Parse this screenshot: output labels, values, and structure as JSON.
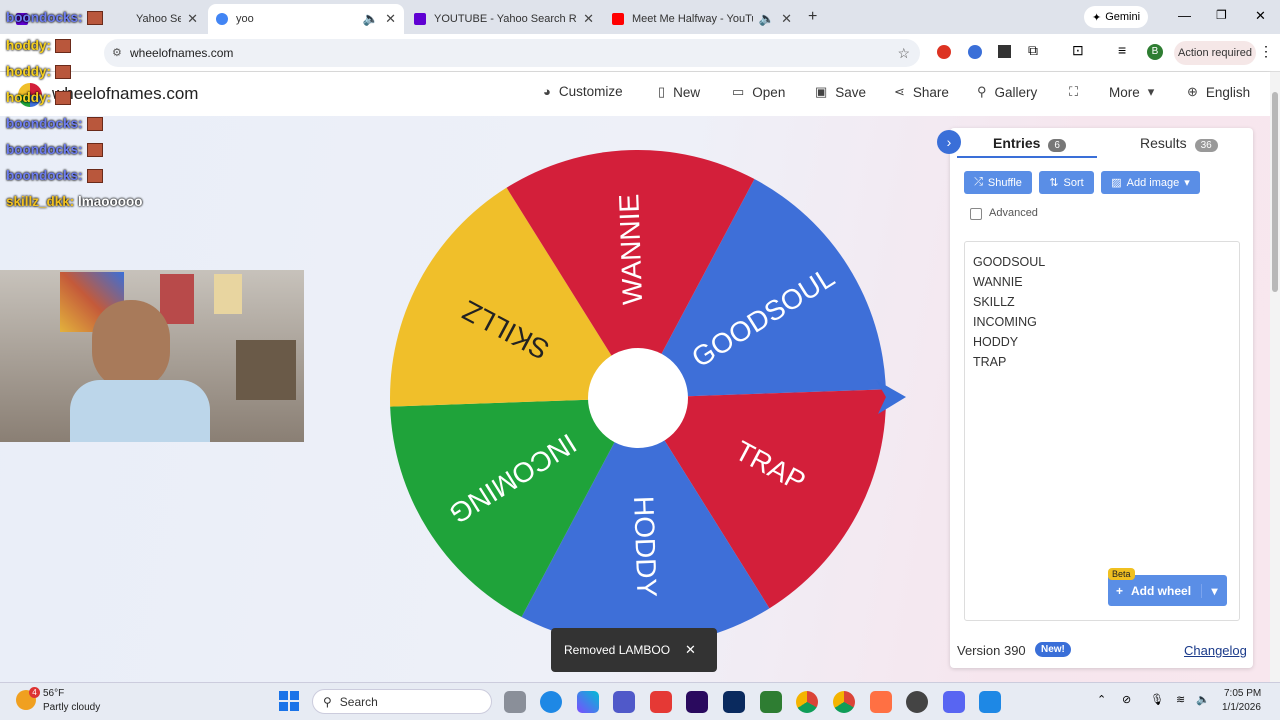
{
  "tabs": [
    {
      "title": "Yahoo Search",
      "favicon_color": "#6001d2"
    },
    {
      "title": "yoo",
      "favicon_color": "#4285f4"
    },
    {
      "title": "YOUTUBE - Yahoo Search Results",
      "favicon_color": "#6001d2"
    },
    {
      "title": "Meet Me Halfway - YouTube",
      "favicon_color": "#ff0000"
    }
  ],
  "gemini_label": "Gemini",
  "address": {
    "url": "wheelofnames.com",
    "action_required": "Action required",
    "profile_initial": "B"
  },
  "site": {
    "logo": "wheelofnames.com",
    "nav": {
      "customize": "Customize",
      "new": "New",
      "open": "Open",
      "save": "Save",
      "share": "Share",
      "gallery": "Gallery",
      "more": "More",
      "language": "English"
    }
  },
  "panel": {
    "entries_tab": "Entries",
    "entries_count": "6",
    "results_tab": "Results",
    "results_count": "36",
    "shuffle": "Shuffle",
    "sort": "Sort",
    "add_image": "Add image",
    "advanced": "Advanced",
    "entries": [
      "GOODSOUL",
      "WANNIE",
      "SKILLZ",
      "INCOMING",
      "HODDY",
      "TRAP"
    ],
    "beta": "Beta",
    "add_wheel": "Add wheel",
    "version": "Version 390",
    "new_badge": "New!",
    "changelog": "Changelog"
  },
  "wheel": {
    "slices": [
      {
        "label": "GOODSOUL",
        "color": "#3e6fd8"
      },
      {
        "label": "TRAP",
        "color": "#d31f3a"
      },
      {
        "label": "HODDY",
        "color": "#3e6fd8"
      },
      {
        "label": "INCOMING",
        "color": "#1fa33a"
      },
      {
        "label": "SKILLZ",
        "color": "#f0bf2a"
      },
      {
        "label": "WANNIE",
        "color": "#d31f3a"
      }
    ]
  },
  "toast": {
    "text": "Removed LAMBOO",
    "close": "✕"
  },
  "chat": [
    {
      "user": "boondocks:",
      "msg": "",
      "color": "u2"
    },
    {
      "user": "hoddy:",
      "msg": "",
      "color": "u1"
    },
    {
      "user": "hoddy:",
      "msg": "",
      "color": "u1"
    },
    {
      "user": "hoddy:",
      "msg": "",
      "color": "u1"
    },
    {
      "user": "boondocks:",
      "msg": "",
      "color": "u2"
    },
    {
      "user": "boondocks:",
      "msg": "",
      "color": "u2"
    },
    {
      "user": "boondocks:",
      "msg": "",
      "color": "u2"
    },
    {
      "user": "skillz_dkk:",
      "msg": "lmaooooo",
      "color": "u3"
    }
  ],
  "weather": {
    "temp": "56°F",
    "desc": "Partly cloudy",
    "badge": "4"
  },
  "taskbar": {
    "search": "Search",
    "time": "7:05 PM",
    "date": "1/1/2026"
  }
}
